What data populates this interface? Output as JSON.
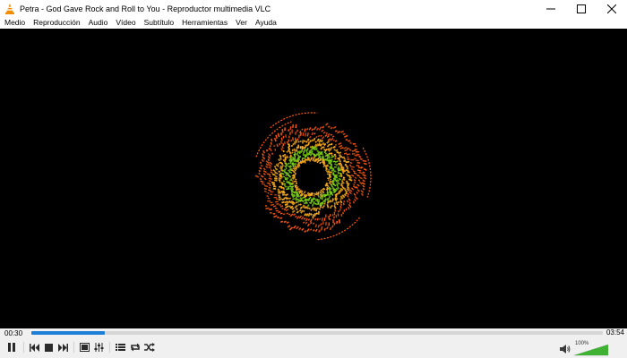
{
  "window": {
    "title": "Petra - God Gave Rock and Roll to You - Reproductor multimedia VLC"
  },
  "menu": {
    "items": [
      "Medio",
      "Reproducción",
      "Audio",
      "Vídeo",
      "Subtítulo",
      "Herramientas",
      "Ver",
      "Ayuda"
    ]
  },
  "playback": {
    "current_time": "00:30",
    "total_time": "03:54",
    "progress_fraction": 0.128
  },
  "volume": {
    "label": "100%",
    "level_fraction": 1.0
  },
  "colors": {
    "seek_fill": "#1e7fd8",
    "video_bg": "#000000",
    "volume_green": "#3fb234",
    "visualizer_outer": "#ff5a12",
    "visualizer_mid": "#ffb020",
    "visualizer_inner": "#7fd418"
  },
  "icons": {
    "app": "vlc-cone-icon",
    "minimize": "minimize-icon",
    "maximize": "maximize-icon",
    "close": "close-icon",
    "pause": "pause-icon",
    "previous": "previous-icon",
    "stop": "stop-icon",
    "next": "next-icon",
    "fullscreen": "fullscreen-icon",
    "extended": "extended-settings-icon",
    "playlist": "playlist-icon",
    "loop": "loop-icon",
    "shuffle": "shuffle-icon",
    "volume": "speaker-icon"
  }
}
